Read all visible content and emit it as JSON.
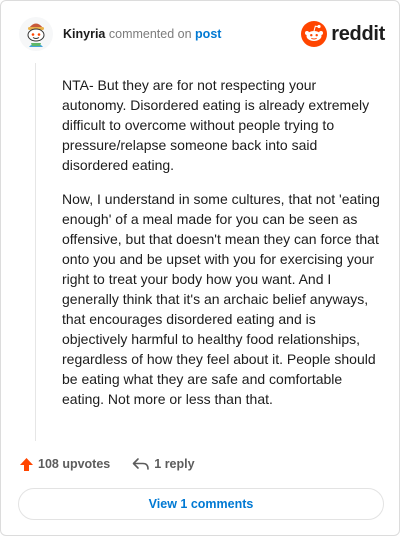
{
  "comment": {
    "username": "Kinyria",
    "commented_on": "commented on",
    "post_link": "post",
    "paragraphs": [
      "NTA- But they are for not respecting your autonomy. Disordered eating is already extremely difficult to overcome without people trying to pressure/relapse someone back into said disordered eating.",
      "Now, I understand in some cultures, that not 'eating enough' of a meal made for you can be seen as offensive, but that doesn't mean they can force that onto you and be upset with you for exercising your right to treat your body how you want. And I generally think that it's an archaic belief anyways, that encourages disordered eating and is objectively harmful to healthy food relationships, regardless of how they feel about it. People should be eating what they are safe and comfortable eating. Not more or less than that."
    ]
  },
  "brand": {
    "logo_text": "reddit",
    "logo_color": "#ff4500"
  },
  "footer": {
    "upvotes": "108 upvotes",
    "replies": "1 reply",
    "upvote_color": "#ff4500"
  },
  "view_button": {
    "label": "View 1 comments",
    "color": "#0079d3"
  },
  "icons": {
    "avatar": "snoo-avatar-icon",
    "logo": "reddit-logo-icon",
    "upvote": "upvote-arrow-icon",
    "reply": "reply-arrow-icon"
  }
}
